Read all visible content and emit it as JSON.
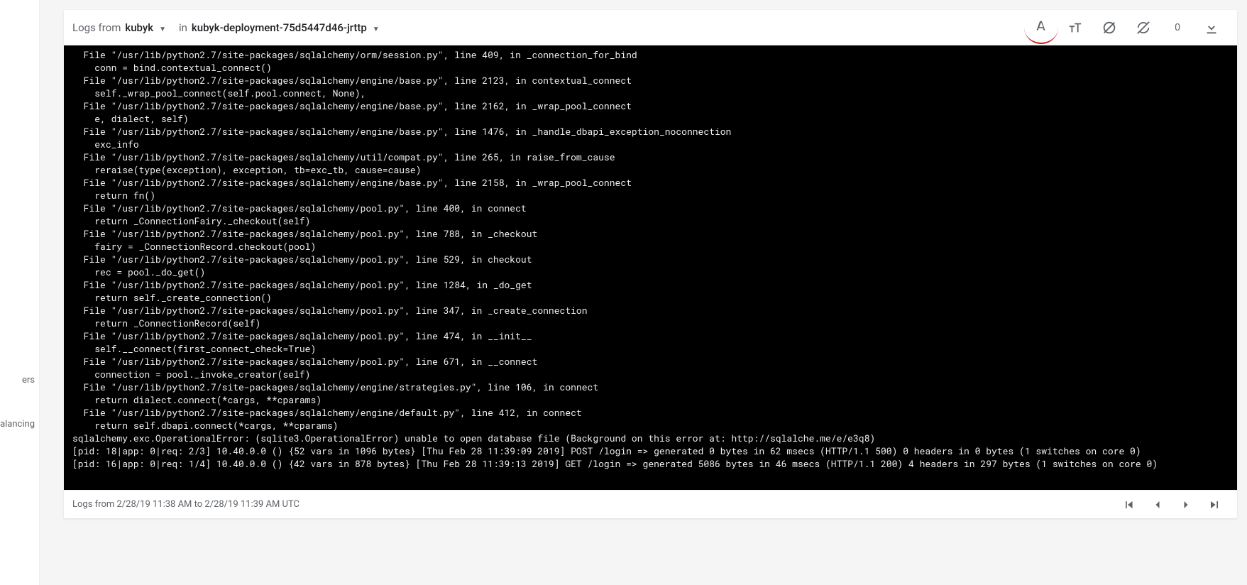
{
  "header": {
    "logs_from_label": "Logs from",
    "logs_from_value": "kubyk",
    "in_label": "in",
    "in_value": "kubyk-deployment-75d5447d46-jrttp",
    "count": "0"
  },
  "sidebar": {
    "item_ers": "ers",
    "item_alancing": "alancing"
  },
  "footer": {
    "range": "Logs from 2/28/19 11:38 AM to 2/28/19 11:39 AM UTC"
  },
  "log_lines": [
    "  File \"/usr/lib/python2.7/site-packages/sqlalchemy/orm/session.py\", line 409, in _connection_for_bind",
    "    conn = bind.contextual_connect()",
    "  File \"/usr/lib/python2.7/site-packages/sqlalchemy/engine/base.py\", line 2123, in contextual_connect",
    "    self._wrap_pool_connect(self.pool.connect, None),",
    "  File \"/usr/lib/python2.7/site-packages/sqlalchemy/engine/base.py\", line 2162, in _wrap_pool_connect",
    "    e, dialect, self)",
    "  File \"/usr/lib/python2.7/site-packages/sqlalchemy/engine/base.py\", line 1476, in _handle_dbapi_exception_noconnection",
    "    exc_info",
    "  File \"/usr/lib/python2.7/site-packages/sqlalchemy/util/compat.py\", line 265, in raise_from_cause",
    "    reraise(type(exception), exception, tb=exc_tb, cause=cause)",
    "  File \"/usr/lib/python2.7/site-packages/sqlalchemy/engine/base.py\", line 2158, in _wrap_pool_connect",
    "    return fn()",
    "  File \"/usr/lib/python2.7/site-packages/sqlalchemy/pool.py\", line 400, in connect",
    "    return _ConnectionFairy._checkout(self)",
    "  File \"/usr/lib/python2.7/site-packages/sqlalchemy/pool.py\", line 788, in _checkout",
    "    fairy = _ConnectionRecord.checkout(pool)",
    "  File \"/usr/lib/python2.7/site-packages/sqlalchemy/pool.py\", line 529, in checkout",
    "    rec = pool._do_get()",
    "  File \"/usr/lib/python2.7/site-packages/sqlalchemy/pool.py\", line 1284, in _do_get",
    "    return self._create_connection()",
    "  File \"/usr/lib/python2.7/site-packages/sqlalchemy/pool.py\", line 347, in _create_connection",
    "    return _ConnectionRecord(self)",
    "  File \"/usr/lib/python2.7/site-packages/sqlalchemy/pool.py\", line 474, in __init__",
    "    self.__connect(first_connect_check=True)",
    "  File \"/usr/lib/python2.7/site-packages/sqlalchemy/pool.py\", line 671, in __connect",
    "    connection = pool._invoke_creator(self)",
    "  File \"/usr/lib/python2.7/site-packages/sqlalchemy/engine/strategies.py\", line 106, in connect",
    "    return dialect.connect(*cargs, **cparams)",
    "  File \"/usr/lib/python2.7/site-packages/sqlalchemy/engine/default.py\", line 412, in connect",
    "    return self.dbapi.connect(*cargs, **cparams)",
    "sqlalchemy.exc.OperationalError: (sqlite3.OperationalError) unable to open database file (Background on this error at: http://sqlalche.me/e/e3q8)",
    "[pid: 18|app: 0|req: 2/3] 10.40.0.0 () {52 vars in 1096 bytes} [Thu Feb 28 11:39:09 2019] POST /login => generated 0 bytes in 62 msecs (HTTP/1.1 500) 0 headers in 0 bytes (1 switches on core 0)",
    "[pid: 16|app: 0|req: 1/4] 10.40.0.0 () {42 vars in 878 bytes} [Thu Feb 28 11:39:13 2019] GET /login => generated 5086 bytes in 46 msecs (HTTP/1.1 200) 4 headers in 297 bytes (1 switches on core 0)"
  ]
}
